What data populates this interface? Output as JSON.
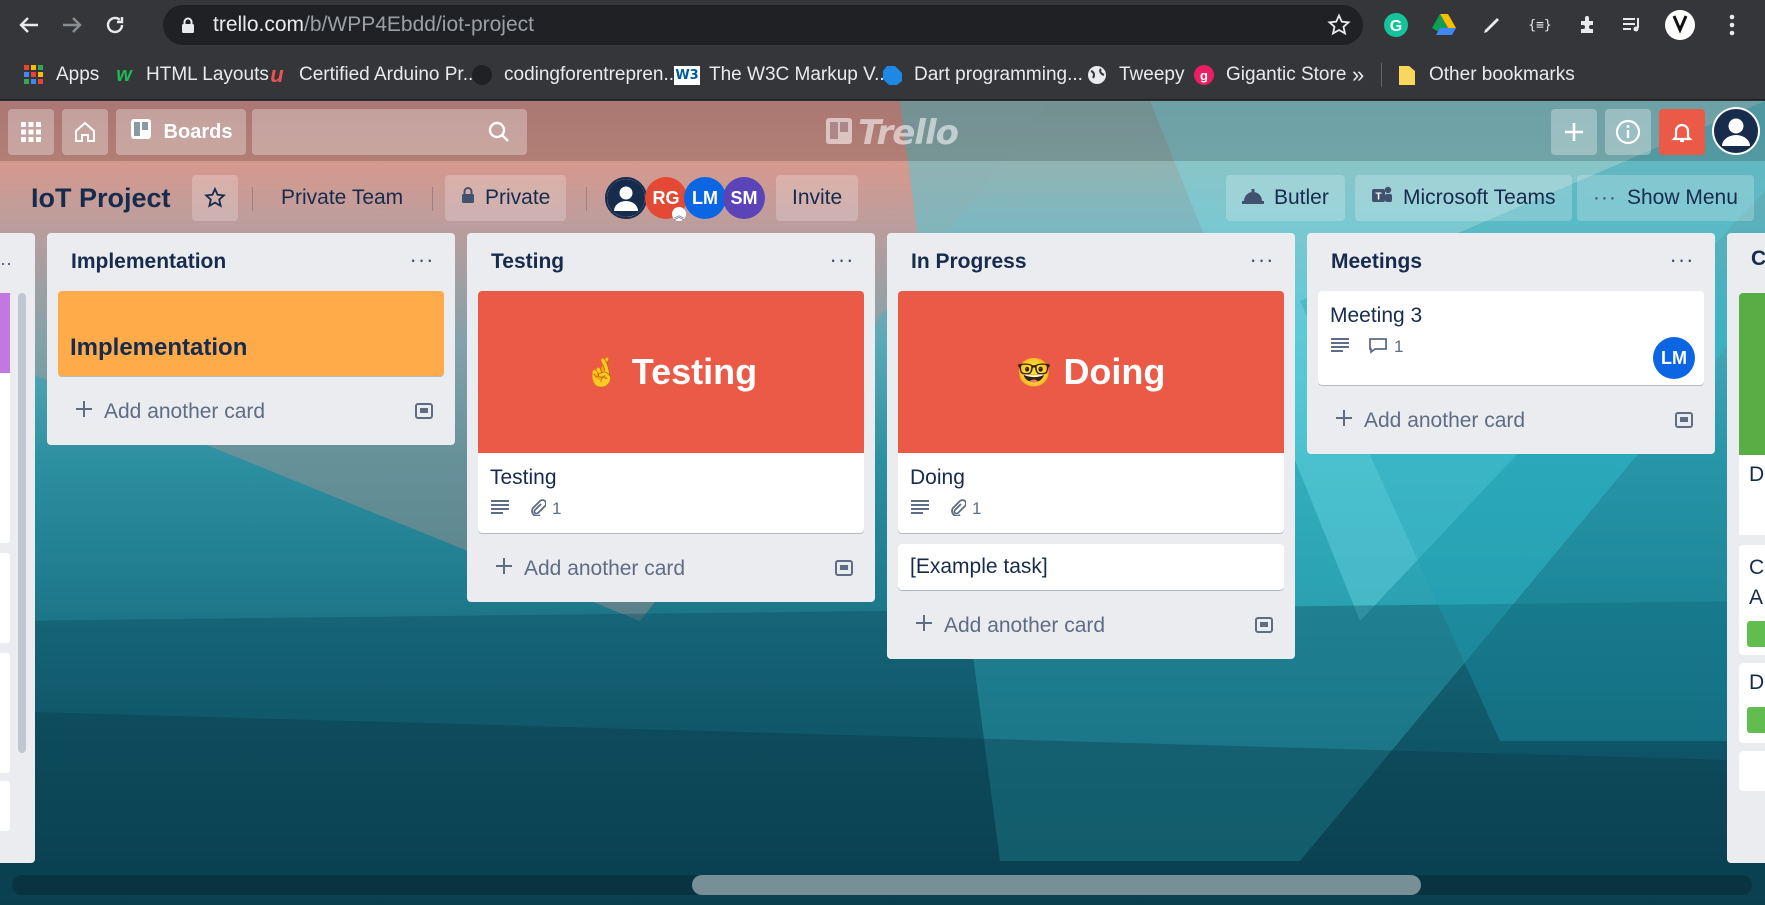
{
  "browser": {
    "url_host": "trello.com",
    "url_path": "/b/WPP4Ebdd/iot-project",
    "bookmarks": [
      {
        "label": "Apps",
        "icon": "apps-grid-icon"
      },
      {
        "label": "HTML Layouts",
        "icon": "w3layouts-icon"
      },
      {
        "label": "Certified Arduino Pr...",
        "icon": "udemy-icon"
      },
      {
        "label": "codingforentrepren...",
        "icon": "github-icon"
      },
      {
        "label": "The W3C Markup V...",
        "icon": "w3c-icon"
      },
      {
        "label": "Dart programming...",
        "icon": "dart-icon"
      },
      {
        "label": "Tweepy",
        "icon": "globe-icon"
      },
      {
        "label": "Gigantic Store",
        "icon": "gigantic-icon"
      }
    ],
    "more_bookmarks": "»",
    "other_bookmarks": "Other bookmarks"
  },
  "header": {
    "boards_label": "Boards",
    "logo_text": "Trello"
  },
  "board": {
    "title": "IoT Project",
    "team": "Private Team",
    "visibility": "Private",
    "members": [
      {
        "initials": "",
        "color": "#172b4d"
      },
      {
        "initials": "RG",
        "color": "#e34935"
      },
      {
        "initials": "LM",
        "color": "#0c66e4"
      },
      {
        "initials": "SM",
        "color": "#5a44b8"
      }
    ],
    "invite_label": "Invite",
    "butler_label": "Butler",
    "teams_label": "Microsoft Teams",
    "menu_label": "Show Menu"
  },
  "lists": [
    {
      "title": "Implementation",
      "cards": [
        {
          "cover_color": "#ffab4a",
          "cover_title": "Implementation"
        }
      ],
      "add_label": "Add another card"
    },
    {
      "title": "Testing",
      "cards": [
        {
          "cover_color": "#eb5a46",
          "cover_emoji": "🤞",
          "cover_text": "Testing",
          "title": "Testing",
          "attachments": "1"
        }
      ],
      "add_label": "Add another card"
    },
    {
      "title": "In Progress",
      "cards": [
        {
          "cover_color": "#eb5a46",
          "cover_emoji": "🤓",
          "cover_text": "Doing",
          "title": "Doing",
          "attachments": "1"
        },
        {
          "title": "[Example task]"
        }
      ],
      "add_label": "Add another card"
    },
    {
      "title": "Meetings",
      "cards": [
        {
          "title": "Meeting 3",
          "comments": "1",
          "member": "LM"
        }
      ],
      "add_label": "Add another card"
    }
  ],
  "partial_list_right": {
    "title_fragment": "C",
    "card_fragments": [
      "D",
      "C",
      "A",
      "D"
    ]
  },
  "colors": {
    "header_overlay": "rgba(0,0,0,0.16)",
    "list_bg": "#ebecf0",
    "notification_red": "#eb5a46",
    "member_blue": "#0c66e4"
  }
}
